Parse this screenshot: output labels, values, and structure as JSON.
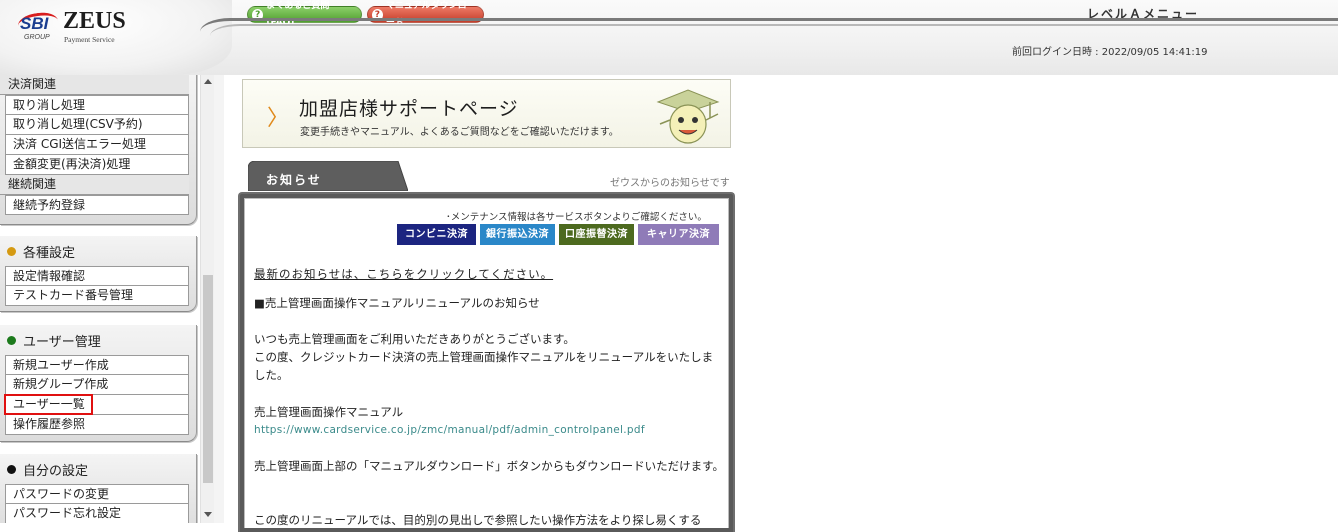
{
  "header": {
    "logo": {
      "brand": "SBI",
      "group": "GROUP",
      "name": "ZEUS",
      "subtitle": "Payment Service"
    },
    "faq_button": "よくあるご質問(FAQ)",
    "manual_download_button": "マニュアルダウンロード",
    "menu_title": "レベルＡメニュー",
    "last_login": "前回ログイン日時 : 2022/09/05 14:41:19"
  },
  "sidebar": {
    "settlement": {
      "section_label": "決済関連",
      "items": [
        "取り消し処理",
        "取り消し処理(CSV予約)",
        "決済 CGI送信エラー処理",
        "金額変更(再決済)処理"
      ],
      "sub_label": "継続関連",
      "sub_items": [
        "継続予約登録"
      ]
    },
    "settings": {
      "title": "各種設定",
      "items": [
        "設定情報確認",
        "テストカード番号管理"
      ]
    },
    "user_management": {
      "title": "ユーザー管理",
      "items": [
        "新規ユーザー作成",
        "新規グループ作成",
        "ユーザー一覧",
        "操作履歴参照"
      ]
    },
    "my_settings": {
      "title": "自分の設定",
      "items": [
        "パスワードの変更",
        "パスワード忘れ設定"
      ]
    }
  },
  "main": {
    "banner": {
      "title": "加盟店様サポートページ",
      "subtitle": "変更手続きやマニュアル、よくあるご質問などをご確認いただけます。"
    },
    "news": {
      "tab_label": "お知らせ",
      "source_note": "ゼウスからのお知らせです",
      "maintenance_note": "･メンテナンス情報は各サービスボタンよりご確認ください。",
      "service_buttons": [
        "コンビニ決済",
        "銀行振込決済",
        "口座振替決済",
        "キャリア決済"
      ],
      "latest_link": "最新のお知らせは、こちらをクリックしてください。",
      "heading": "■売上管理画面操作マニュアルリニューアルのお知らせ",
      "para1": "いつも売上管理画面をご利用いただきありがとうございます。",
      "para2": "この度、クレジットカード決済の売上管理画面操作マニュアルをリニューアルをいたしました。",
      "manual_label": "売上管理画面操作マニュアル",
      "manual_url": "https://www.cardservice.co.jp/zmc/manual/pdf/admin_controlpanel.pdf",
      "para3": "売上管理画面上部の「マニュアルダウンロード」ボタンからもダウンロードいただけます。",
      "para4": "この度のリニューアルでは、目的別の見出しで参照したい操作方法をより探し易くする"
    }
  },
  "colors": {
    "highlight_border": "#e01010",
    "faq_green": "#4f9e2f",
    "download_red": "#c43d2a",
    "banner_chevron": "#e08a1c"
  }
}
